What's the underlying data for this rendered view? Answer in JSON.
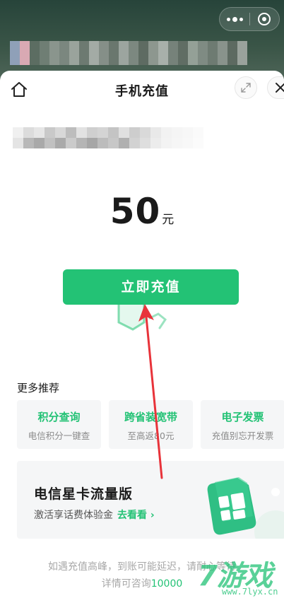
{
  "header": {
    "title": "手机充值"
  },
  "recharge": {
    "amount": "50",
    "unit": "元",
    "cta_label": "立即充值"
  },
  "more": {
    "section_title": "更多推荐",
    "cards": [
      {
        "title": "积分查询",
        "desc": "电信积分一键查"
      },
      {
        "title": "跨省装宽带",
        "desc": "至高返80元"
      },
      {
        "title": "电子发票",
        "desc": "充值别忘开发票"
      }
    ]
  },
  "promo": {
    "title": "电信星卡流量版",
    "subtitle": "激活享话费体验金",
    "link_label": "去看看 ›"
  },
  "footer": {
    "line1": "如遇充值高峰，到账可能延迟，请耐心等待",
    "line2_prefix": "详情可咨询",
    "phone": "10000"
  },
  "watermark": {
    "main": "7游戏",
    "url": "www.7lyx.cn"
  },
  "colors": {
    "accent": "#23c275",
    "annotation_arrow": "#e8333a"
  },
  "icons": [
    "home-icon",
    "expand-icon",
    "close-icon",
    "more-icon",
    "capsule-close-icon"
  ]
}
